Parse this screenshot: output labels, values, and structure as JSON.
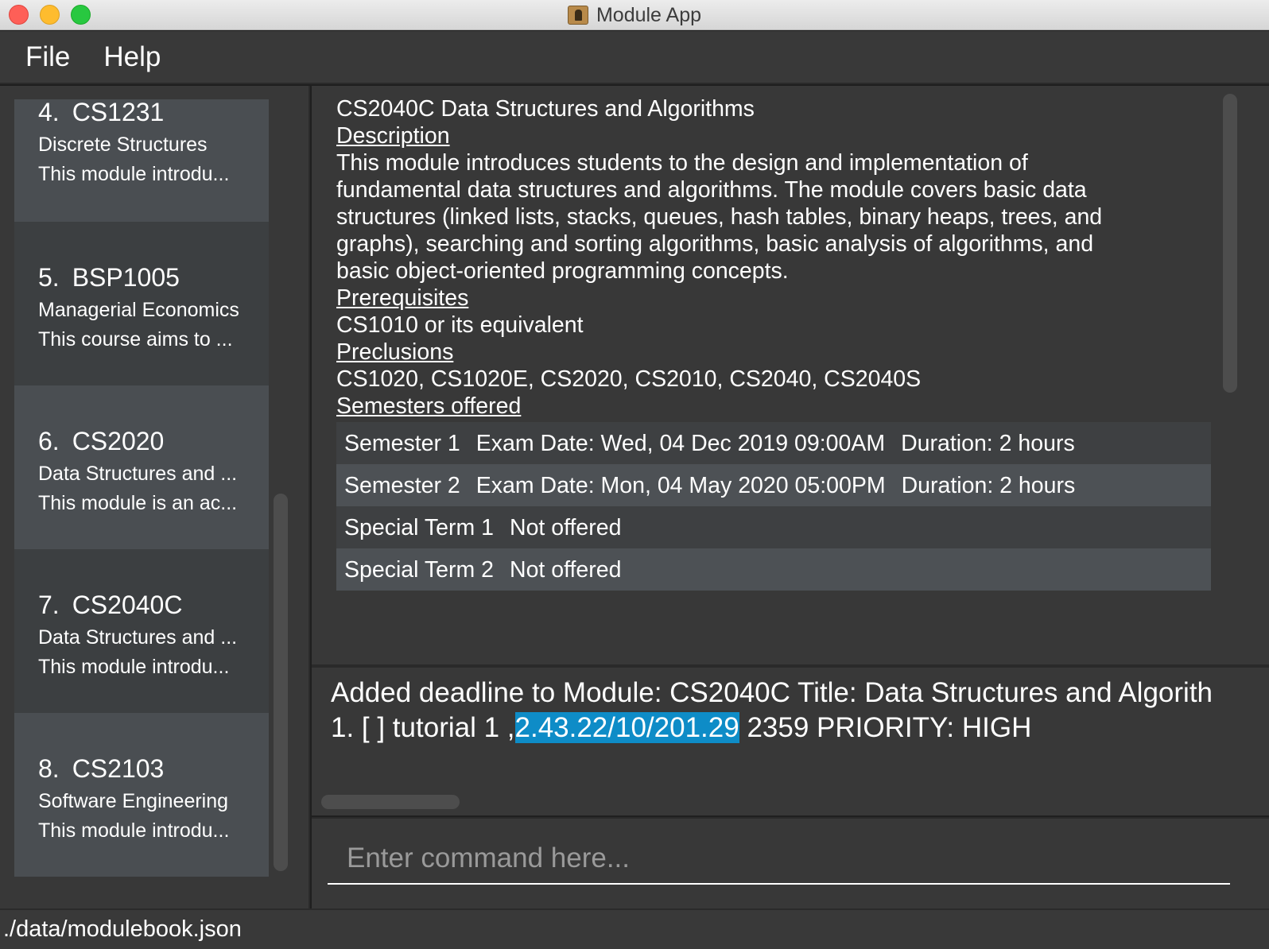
{
  "window": {
    "title": "Module App"
  },
  "menu": {
    "file": "File",
    "help": "Help"
  },
  "modules": [
    {
      "index": "4.",
      "code": "CS1231",
      "title": "Discrete Structures",
      "desc": "This module introdu..."
    },
    {
      "index": "5.",
      "code": "BSP1005",
      "title": "Managerial Economics",
      "desc": "This course aims to ..."
    },
    {
      "index": "6.",
      "code": "CS2020",
      "title": "Data Structures and ...",
      "desc": "This module is an ac..."
    },
    {
      "index": "7.",
      "code": "CS2040C",
      "title": "Data Structures and ...",
      "desc": "This module introdu..."
    },
    {
      "index": "8.",
      "code": "CS2103",
      "title": "Software Engineering",
      "desc": "This module introdu..."
    }
  ],
  "detail": {
    "title": "CS2040C Data Structures and Algorithms",
    "description_label": "Description",
    "description_lines": [
      "This module introduces students to the design and implementation of",
      "fundamental data structures and algorithms. The module covers basic data",
      "structures (linked lists, stacks, queues, hash tables, binary heaps, trees, and",
      "graphs), searching and sorting algorithms, basic analysis of algorithms, and",
      "basic object-oriented programming concepts."
    ],
    "prerequisites_label": "Prerequisites",
    "prerequisites": "CS1010 or its equivalent",
    "preclusions_label": "Preclusions",
    "preclusions": "CS1020, CS1020E, CS2020, CS2010, CS2040, CS2040S",
    "semesters_label": "Semesters offered",
    "semesters": [
      {
        "name": "Semester 1",
        "exam": "Exam Date: Wed, 04 Dec 2019 09:00AM",
        "duration": "Duration: 2 hours"
      },
      {
        "name": "Semester 2",
        "exam": "Exam Date: Mon, 04 May 2020 05:00PM",
        "duration": "Duration: 2 hours"
      },
      {
        "name": "Special Term 1",
        "exam": "Not offered",
        "duration": ""
      },
      {
        "name": "Special Term 2",
        "exam": "Not offered",
        "duration": ""
      }
    ]
  },
  "result": {
    "line1": "Added deadline to Module: CS2040C Title: Data Structures and Algorith",
    "line2_prefix": "1. [ ] tutorial 1 ,",
    "line2_highlight": "2.43.22/10/201.29",
    "line2_suffix": " 2359 PRIORITY: HIGH"
  },
  "command": {
    "placeholder": "Enter command here..."
  },
  "status": {
    "path": "./data/modulebook.json"
  },
  "colors": {
    "highlight": "#0e8cc7",
    "background": "#383838",
    "card_dark": "#4a4e52"
  }
}
